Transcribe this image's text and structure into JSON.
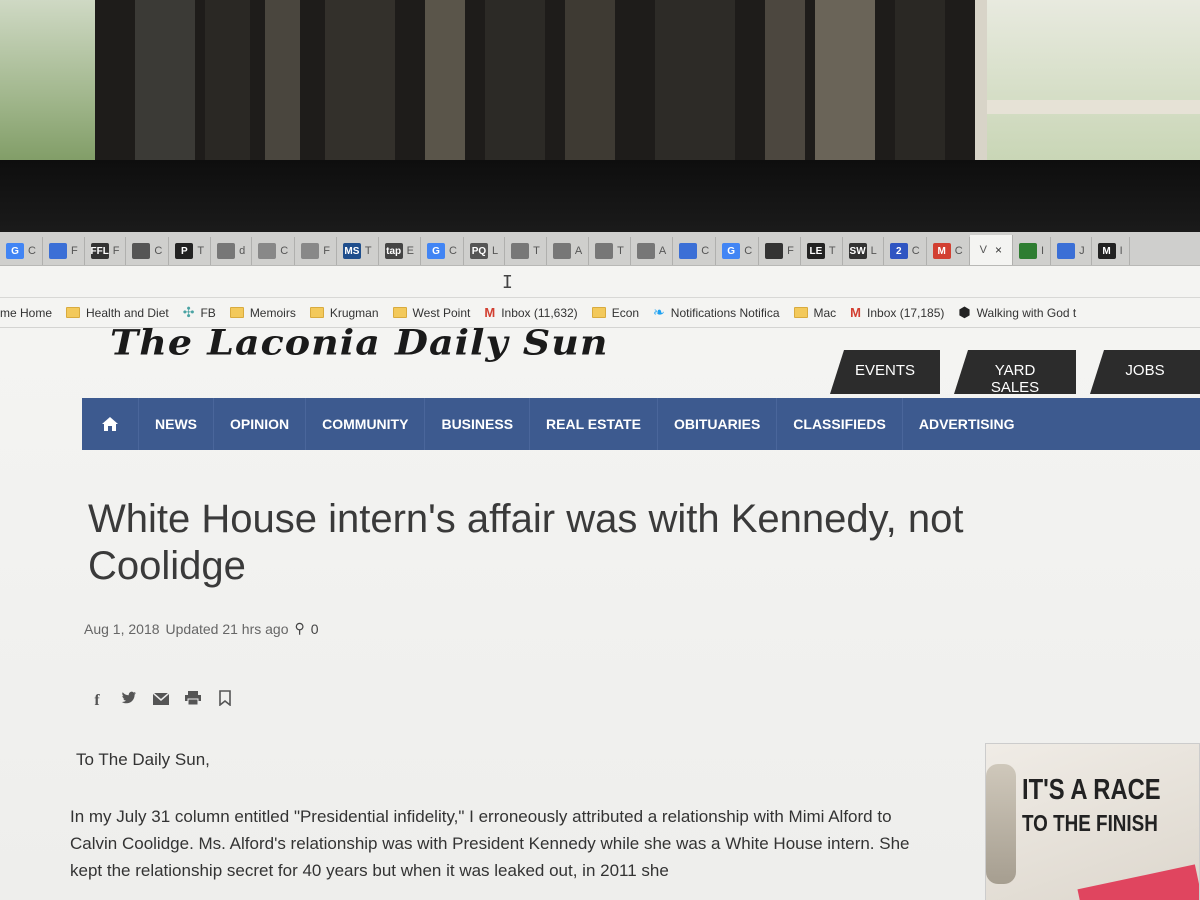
{
  "browser": {
    "tabs": [
      {
        "label": "C",
        "favicon": "G",
        "color": "#4285f4"
      },
      {
        "label": "F",
        "favicon": "contact-card-icon",
        "color": "#3b6fd6"
      },
      {
        "label": "F",
        "favicon": "FFL",
        "color": "#333333"
      },
      {
        "label": "C",
        "favicon": "grid-icon",
        "color": "#555555"
      },
      {
        "label": "T",
        "favicon": "P",
        "color": "#222222"
      },
      {
        "label": "d",
        "favicon": "doc-icon",
        "color": "#777777"
      },
      {
        "label": "C",
        "favicon": "chart-icon",
        "color": "#888888"
      },
      {
        "label": "F",
        "favicon": "chart-icon",
        "color": "#888888"
      },
      {
        "label": "T",
        "favicon": "MS",
        "color": "#1f4e8c"
      },
      {
        "label": "E",
        "favicon": "tap",
        "color": "#444444"
      },
      {
        "label": "C",
        "favicon": "G",
        "color": "#4285f4"
      },
      {
        "label": "L",
        "favicon": "PQ",
        "color": "#555555"
      },
      {
        "label": "T",
        "favicon": "doc-icon",
        "color": "#777777"
      },
      {
        "label": "A",
        "favicon": "doc-icon",
        "color": "#777777"
      },
      {
        "label": "T",
        "favicon": "doc-icon",
        "color": "#777777"
      },
      {
        "label": "A",
        "favicon": "doc-icon",
        "color": "#777777"
      },
      {
        "label": "C",
        "favicon": "contact-card-icon",
        "color": "#3b6fd6"
      },
      {
        "label": "C",
        "favicon": "G",
        "color": "#4285f4"
      },
      {
        "label": "F",
        "favicon": "plane-icon",
        "color": "#333333"
      },
      {
        "label": "T",
        "favicon": "LE",
        "color": "#222222"
      },
      {
        "label": "L",
        "favicon": "SW",
        "color": "#333333"
      },
      {
        "label": "C",
        "favicon": "2",
        "color": "#2f55c2"
      },
      {
        "label": "C",
        "favicon": "M",
        "color": "#d23f31"
      },
      {
        "label": "V",
        "favicon": "",
        "color": "#f4f4f2",
        "active": true
      },
      {
        "label": "I",
        "favicon": "circle-icon",
        "color": "#2e7d32"
      },
      {
        "label": "J",
        "favicon": "contact-card-icon",
        "color": "#3b6fd6"
      },
      {
        "label": "I",
        "favicon": "M",
        "color": "#222222"
      }
    ],
    "bookmarks": [
      {
        "label": "me Home",
        "icon": "none"
      },
      {
        "label": "Health and Diet",
        "icon": "folder-icon"
      },
      {
        "label": "FB",
        "icon": "fb-icon"
      },
      {
        "label": "Memoirs",
        "icon": "folder-icon"
      },
      {
        "label": "Krugman",
        "icon": "folder-icon"
      },
      {
        "label": "West Point",
        "icon": "folder-icon"
      },
      {
        "label": "Inbox (11,632)",
        "icon": "gmail-icon"
      },
      {
        "label": "Econ",
        "icon": "folder-icon"
      },
      {
        "label": "Notifications Notifica",
        "icon": "twitter-icon"
      },
      {
        "label": "Mac",
        "icon": "folder-icon"
      },
      {
        "label": "Inbox (17,185)",
        "icon": "gmail-icon"
      },
      {
        "label": "Walking with God t",
        "icon": "hexagon-icon"
      }
    ]
  },
  "site": {
    "masthead": "The Laconia Daily Sun",
    "top_nav": [
      "EVENTS",
      "YARD SALES",
      "JOBS"
    ],
    "main_nav": [
      "NEWS",
      "OPINION",
      "COMMUNITY",
      "BUSINESS",
      "REAL ESTATE",
      "OBITUARIES",
      "CLASSIFIEDS",
      "ADVERTISING"
    ]
  },
  "article": {
    "headline": "White House intern's affair was with Kennedy, not Coolidge",
    "date": "Aug 1, 2018",
    "updated": "Updated 21 hrs ago",
    "comment_count": "0",
    "salutation": "To The Daily Sun,",
    "paragraph": "In my July 31 column entitled \"Presidential infidelity,\" I erroneously attributed a relationship with Mimi Alford to Calvin Coolidge. Ms. Alford's relationship was with President Kennedy while she was a White House intern. She kept the relationship secret for 40 years but when it was leaked out, in 2011 she"
  },
  "ad": {
    "line1": "IT'S A RACE",
    "line2": "TO THE FINISH"
  },
  "colors": {
    "nav_blue": "#3d5a8f",
    "top_tab_dark": "#2c2c2c",
    "headline_text": "#3a3a3a"
  }
}
